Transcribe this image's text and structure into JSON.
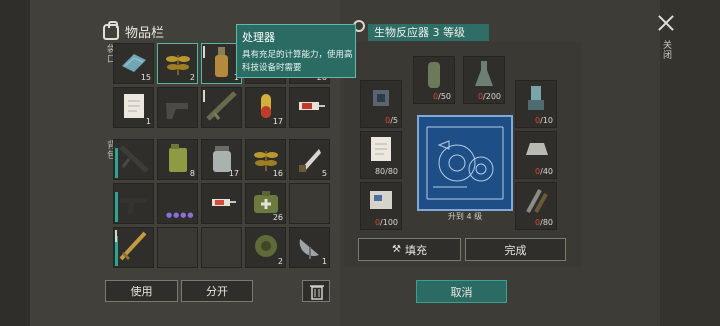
{
  "inventory": {
    "title": "物品栏",
    "pocket_label": "袋口",
    "backpack_label": "背包",
    "pocket_rows": [
      [
        {
          "icon": "blue-cloth-icon",
          "count": "15"
        },
        {
          "icon": "herb-icon",
          "count": "2"
        },
        {
          "icon": "bottle-icon",
          "count": "1"
        },
        {
          "icon": "shotgun-icon",
          "count": ""
        },
        {
          "icon": "syringe-icon",
          "count": "20"
        }
      ],
      [
        {
          "icon": "paper-bandage-icon",
          "count": "1"
        },
        {
          "icon": "pistol-icon",
          "count": ""
        },
        {
          "icon": "rifle-icon",
          "count": ""
        },
        {
          "icon": "capsule-icon",
          "count": "17"
        },
        {
          "icon": "syringe-red-icon",
          "count": ""
        }
      ]
    ],
    "backpack_rows": [
      [
        {
          "icon": "rifle-dark-icon",
          "count": ""
        },
        {
          "icon": "jerrycan-icon",
          "count": "8"
        },
        {
          "icon": "jar-icon",
          "count": "17"
        },
        {
          "icon": "herb-icon",
          "count": "16"
        },
        {
          "icon": "blade-icon",
          "count": "5"
        }
      ],
      [
        {
          "icon": "smg-icon",
          "count": ""
        },
        {
          "icon": "assault-rifle-icon",
          "count": ""
        },
        {
          "icon": "syringe-icon",
          "count": ""
        },
        {
          "icon": "medkit-icon",
          "count": "26"
        },
        {
          "icon": "",
          "count": ""
        }
      ],
      [
        {
          "icon": "shotgun-gold-icon",
          "count": ""
        },
        {
          "icon": "",
          "count": ""
        },
        {
          "icon": "",
          "count": ""
        },
        {
          "icon": "landmine-icon",
          "count": "2"
        },
        {
          "icon": "radar-dish-icon",
          "count": "1"
        }
      ]
    ],
    "use_label": "使用",
    "split_label": "分开"
  },
  "tooltip": {
    "title": "处理器",
    "body": "具有充足的计算能力，使用高科技设备时需要"
  },
  "craft": {
    "title": "生物反应器 3 等级",
    "upgrade_caption": "升到 4 级",
    "fill_label": "填充",
    "done_label": "完成",
    "cancel_label": "取消",
    "requirements": [
      {
        "icon": "chip-icon",
        "have": "0",
        "need": "/5"
      },
      {
        "icon": "canister-icon",
        "have": "0",
        "need": "/50"
      },
      {
        "icon": "flask-icon",
        "have": "0",
        "need": "/200"
      },
      {
        "icon": "sensor-icon",
        "have": "0",
        "need": "/10"
      },
      {
        "icon": "paper-bandage-icon",
        "have": "80",
        "need": "/80"
      },
      {
        "icon": "ingot-icon",
        "have": "0",
        "need": "/40"
      },
      {
        "icon": "motherboard-icon",
        "have": "0",
        "need": "/100"
      },
      {
        "icon": "tools-icon",
        "have": "0",
        "need": "/80"
      }
    ]
  },
  "window": {
    "close_label": "关闭"
  },
  "colors": {
    "accent": "#2e6e66",
    "warning": "#d94a3c"
  }
}
